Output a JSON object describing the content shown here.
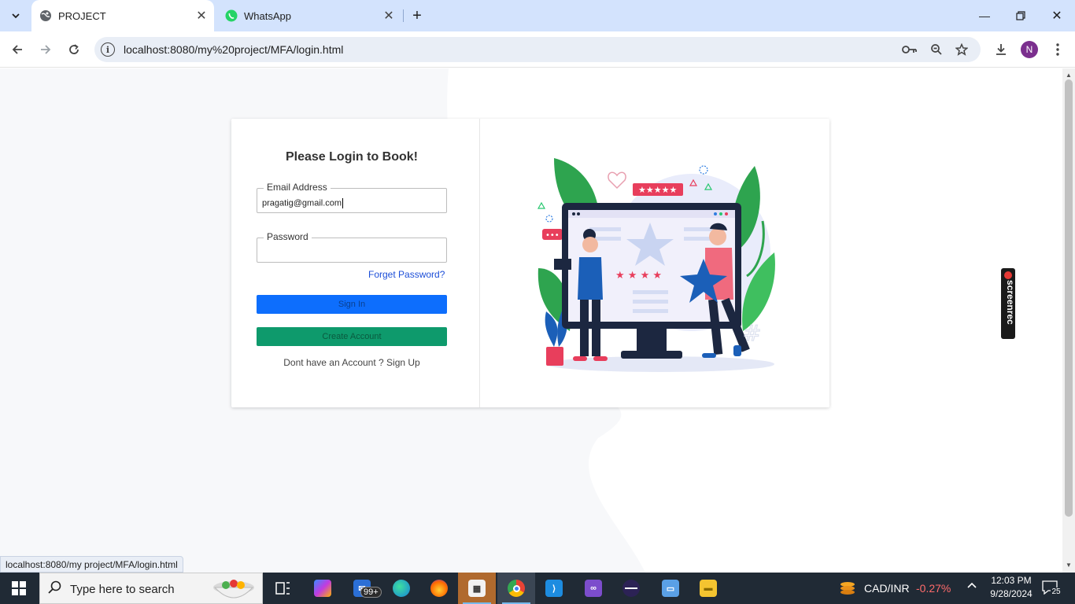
{
  "browser": {
    "tabs": [
      {
        "title": "PROJECT",
        "active": true
      },
      {
        "title": "WhatsApp",
        "active": false
      }
    ],
    "url": "localhost:8080/my%20project/MFA/login.html",
    "profile_initial": "N",
    "status_url": "localhost:8080/my project/MFA/login.html"
  },
  "login": {
    "title": "Please Login to Book!",
    "email_label": "Email Address",
    "email_value": "pragatig@gmail.com",
    "password_label": "Password",
    "password_value": "",
    "forgot_label": "Forget Password?",
    "signin_label": "Sign In",
    "create_label": "Create Account",
    "signup_text": "Dont have an Account ? Sign Up"
  },
  "screenrec": {
    "label": "screenrec"
  },
  "taskbar": {
    "search_placeholder": "Type here to search",
    "mail_badge": "99+",
    "ticker_label": "CAD/INR",
    "ticker_change": "-0.27%",
    "time": "12:03 PM",
    "date": "9/28/2024",
    "notification_count": "25"
  },
  "colors": {
    "signin_button": "#0d6efd",
    "create_button": "#0e9a6c",
    "link": "#1d4fd8",
    "tabstrip": "#d3e3fd",
    "ticker_negative": "#ff6b6b"
  }
}
